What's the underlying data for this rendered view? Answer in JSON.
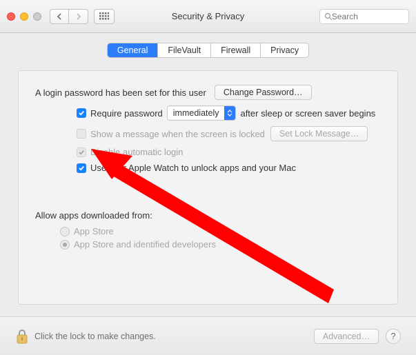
{
  "window": {
    "title": "Security & Privacy"
  },
  "search": {
    "placeholder": "Search"
  },
  "tabs": [
    {
      "label": "General",
      "selected": true
    },
    {
      "label": "FileVault",
      "selected": false
    },
    {
      "label": "Firewall",
      "selected": false
    },
    {
      "label": "Privacy",
      "selected": false
    }
  ],
  "general": {
    "login_password_text": "A login password has been set for this user",
    "change_password_label": "Change Password…",
    "require_password": {
      "checked": true,
      "prefix": "Require password",
      "delay_value": "immediately",
      "suffix": "after sleep or screen saver begins"
    },
    "show_lock_message": {
      "checked": false,
      "label": "Show a message when the screen is locked",
      "button": "Set Lock Message…",
      "disabled": true
    },
    "disable_auto_login": {
      "checked": true,
      "label": "Disable automatic login",
      "disabled": true
    },
    "apple_watch": {
      "checked": true,
      "label": "Use your Apple Watch to unlock apps and your Mac"
    },
    "allow_downloads_heading": "Allow apps downloaded from:",
    "allow_downloads": {
      "disabled": true,
      "options": [
        {
          "label": "App Store",
          "selected": false
        },
        {
          "label": "App Store and identified developers",
          "selected": true
        }
      ]
    }
  },
  "footer": {
    "lock_text": "Click the lock to make changes.",
    "advanced_label": "Advanced…",
    "advanced_disabled": true
  },
  "annotation_arrow_color": "#ff0000"
}
